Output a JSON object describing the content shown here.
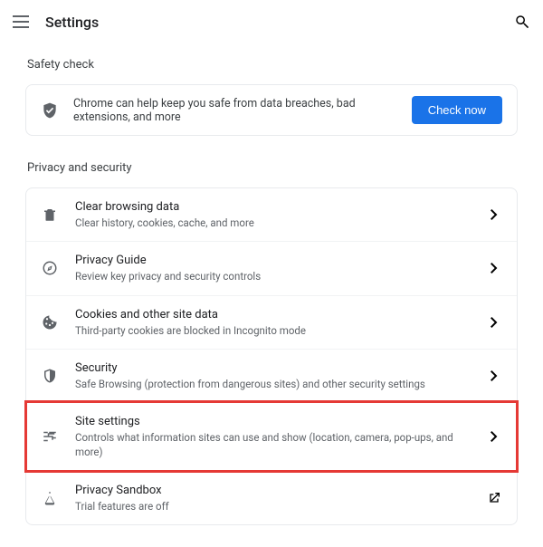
{
  "appbar": {
    "title": "Settings"
  },
  "safety": {
    "heading": "Safety check",
    "message": "Chrome can help keep you safe from data breaches, bad extensions, and more",
    "button": "Check now"
  },
  "privacy": {
    "heading": "Privacy and security",
    "items": [
      {
        "title": "Clear browsing data",
        "subtitle": "Clear history, cookies, cache, and more"
      },
      {
        "title": "Privacy Guide",
        "subtitle": "Review key privacy and security controls"
      },
      {
        "title": "Cookies and other site data",
        "subtitle": "Third-party cookies are blocked in Incognito mode"
      },
      {
        "title": "Security",
        "subtitle": "Safe Browsing (protection from dangerous sites) and other security settings"
      },
      {
        "title": "Site settings",
        "subtitle": "Controls what information sites can use and show (location, camera, pop-ups, and more)"
      },
      {
        "title": "Privacy Sandbox",
        "subtitle": "Trial features are off"
      }
    ]
  }
}
